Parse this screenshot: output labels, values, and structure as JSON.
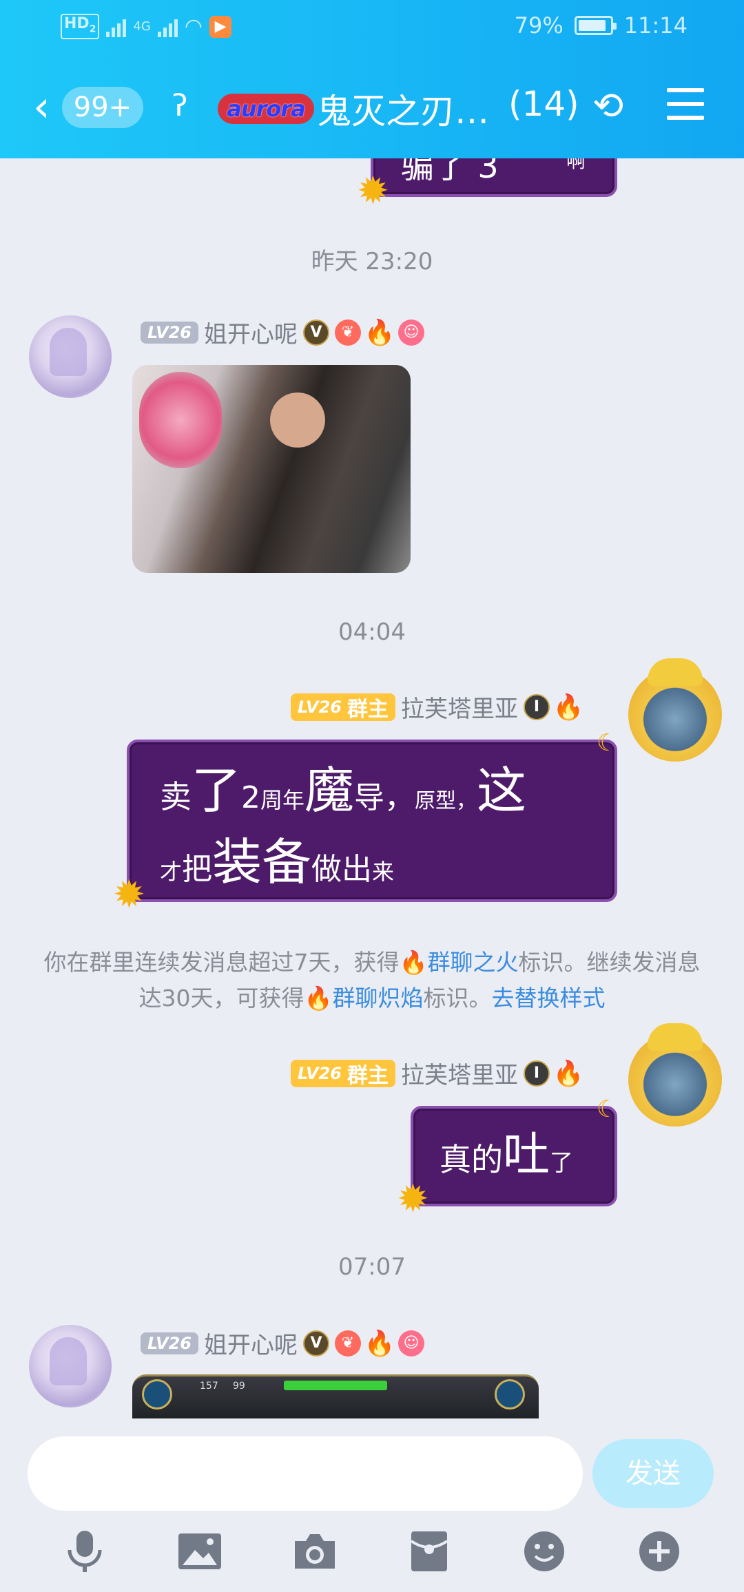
{
  "status_bar": {
    "hd": "HD",
    "hd_sub": "2",
    "network": "4G",
    "battery": "79%",
    "battery_level": 0.79,
    "time": "11:14"
  },
  "header": {
    "back_icon": "chevron-left-icon",
    "unread_count": "99+",
    "ear_icon": "ear-icon",
    "logo_text": "aurora",
    "group_title": "鬼灭之刃…",
    "member_count": "(14)",
    "group_icon": "group-settings-icon",
    "menu_icon": "hamburger-menu-icon"
  },
  "messages": [
    {
      "type": "partial-bubble",
      "side": "right",
      "text": "骗了 3",
      "text_tail": "啊"
    },
    {
      "type": "timestamp",
      "text": "昨天 23:20"
    },
    {
      "type": "image",
      "side": "left",
      "level": "LV26",
      "nickname": "姐开心呢",
      "badges": [
        "v-badge-icon",
        "wings-icon",
        "fire-icon",
        "smile-icon"
      ],
      "image": "meme-gif"
    },
    {
      "type": "timestamp",
      "text": "04:04"
    },
    {
      "type": "text",
      "side": "right",
      "level": "LV26",
      "role": "群主",
      "nickname": "拉芙塔里亚",
      "badges": [
        "rank-badge-icon",
        "fire-icon"
      ],
      "segments": [
        "卖",
        "了",
        "2",
        "周年",
        "魔",
        "导，",
        "原型，",
        "这",
        "才",
        "把",
        "装备",
        "做出",
        "来"
      ]
    },
    {
      "type": "system",
      "prefix": "你在群里连续发消息超过7天，获得",
      "link1": "群聊之火",
      "mid": "标识。继续发消息达30天，可获得",
      "link2": "群聊炽焰",
      "suffix": "标识。",
      "action": "去替换样式"
    },
    {
      "type": "text",
      "side": "right",
      "level": "LV26",
      "role": "群主",
      "nickname": "拉芙塔里亚",
      "badges": [
        "rank-badge-icon",
        "fire-icon"
      ],
      "segments": [
        "真的",
        "吐",
        "了"
      ]
    },
    {
      "type": "timestamp",
      "text": "07:07"
    },
    {
      "type": "image",
      "side": "left",
      "level": "LV26",
      "nickname": "姐开心呢",
      "badges": [
        "v-badge-icon",
        "wings-icon",
        "fire-icon",
        "smile-icon"
      ],
      "image": "game-screenshot",
      "image_text": [
        "157",
        "99"
      ]
    }
  ],
  "input": {
    "placeholder": "",
    "send_label": "发送"
  },
  "toolbar": [
    "microphone-icon",
    "image-icon",
    "camera-icon",
    "red-packet-icon",
    "emoji-icon",
    "plus-icon"
  ],
  "colors": {
    "header": "#18b6f5",
    "background": "#ebedf5",
    "bubble": "#4e1b6a",
    "link": "#3a8cdf",
    "owner_badge": "#ffc53d"
  }
}
